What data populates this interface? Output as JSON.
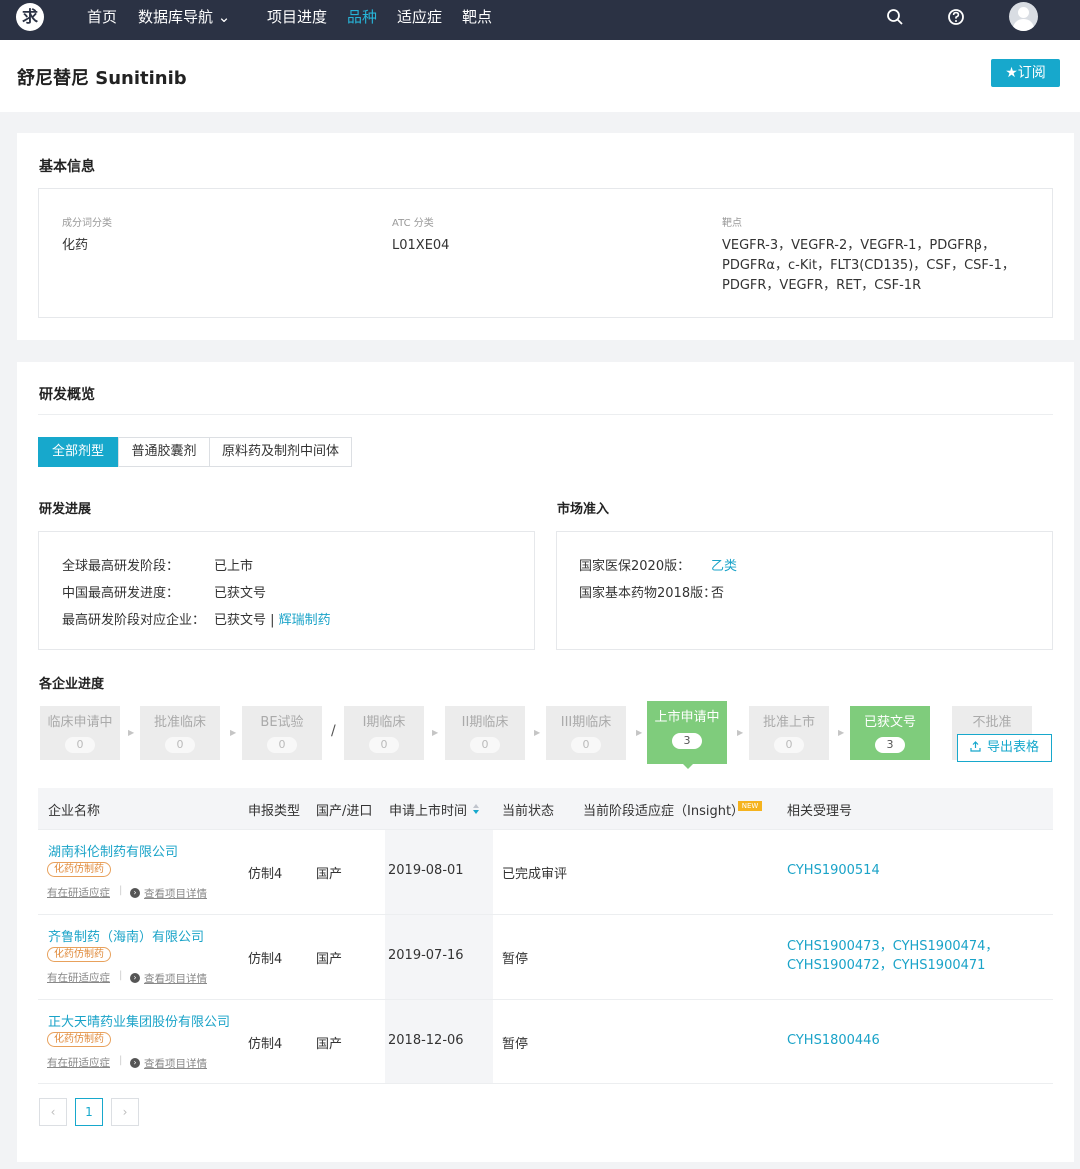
{
  "nav": {
    "logo": "求",
    "items": [
      "首页",
      "数据库导航 ⌄",
      "项目进度",
      "品种",
      "适应症",
      "靶点"
    ]
  },
  "header": {
    "title": "舒尼替尼 Sunitinib",
    "subscribe_label": "★订阅"
  },
  "basic_info": {
    "title": "基本信息",
    "fields": [
      {
        "label": "成分词分类",
        "value": "化药"
      },
      {
        "label": "ATC 分类",
        "value": "L01XE04"
      },
      {
        "label": "靶点",
        "lines": [
          "VEGFR-3，VEGFR-2，VEGFR-1，PDGFRβ，",
          "PDGFRα，c-Kit，FLT3(CD135)，CSF，CSF-1，",
          "PDGFR，VEGFR，RET，CSF-1R"
        ]
      }
    ]
  },
  "overview": {
    "title": "研发概览",
    "tabs": [
      "全部剂型",
      "普通胶囊剂",
      "原料药及制剂中间体"
    ],
    "progress": {
      "title": "研发进展",
      "rows": [
        {
          "key": "全球最高研发阶段：",
          "value": "已上市"
        },
        {
          "key": "中国最高研发进度：",
          "value": "已获文号"
        },
        {
          "key": "最高研发阶段对应企业：",
          "value": "已获文号 | ",
          "link": "辉瑞制药"
        }
      ]
    },
    "market": {
      "title": "市场准入",
      "rows": [
        {
          "key": "国家医保2020版：",
          "link": "乙类"
        },
        {
          "key": "国家基本药物2018版：",
          "value": "否"
        }
      ]
    }
  },
  "company_progress": {
    "title": "各企业进度",
    "stages": [
      {
        "name": "临床申请中",
        "count": "0"
      },
      {
        "name": "批准临床",
        "count": "0"
      },
      {
        "name": "BE试验",
        "count": "0"
      },
      {
        "name": "I期临床",
        "count": "0"
      },
      {
        "name": "II期临床",
        "count": "0"
      },
      {
        "name": "III期临床",
        "count": "0"
      },
      {
        "name": "上市申请中",
        "count": "3"
      },
      {
        "name": "批准上市",
        "count": "0"
      },
      {
        "name": "已获文号",
        "count": "3"
      },
      {
        "name": "不批准",
        "count": ""
      }
    ],
    "slash": "/",
    "export_label": "导出表格"
  },
  "table": {
    "columns": [
      "企业名称",
      "申报类型",
      "国产/进口",
      "申请上市时间",
      "当前状态",
      "当前阶段适应症（Insight）",
      "相关受理号"
    ],
    "new_badge": "NEW",
    "sub_links": [
      "有在研适应症",
      "查看项目详情"
    ],
    "rows": [
      {
        "company": "湖南科伦制药有限公司",
        "tag": "化药仿制药",
        "type": "仿制4",
        "origin": "国产",
        "date": "2019-08-01",
        "status": "已完成审评",
        "indication": "",
        "acceptance": [
          "CYHS1900514"
        ]
      },
      {
        "company": "齐鲁制药（海南）有限公司",
        "tag": "化药仿制药",
        "type": "仿制4",
        "origin": "国产",
        "date": "2019-07-16",
        "status": "暂停",
        "indication": "",
        "acceptance": [
          "CYHS1900473，CYHS1900474，",
          "CYHS1900472，CYHS1900471"
        ]
      },
      {
        "company": "正大天晴药业集团股份有限公司",
        "tag": "化药仿制药",
        "type": "仿制4",
        "origin": "国产",
        "date": "2018-12-06",
        "status": "暂停",
        "indication": "",
        "acceptance": [
          "CYHS1800446"
        ]
      }
    ]
  },
  "pagination": {
    "prev": "‹",
    "current": "1",
    "next": "›"
  }
}
